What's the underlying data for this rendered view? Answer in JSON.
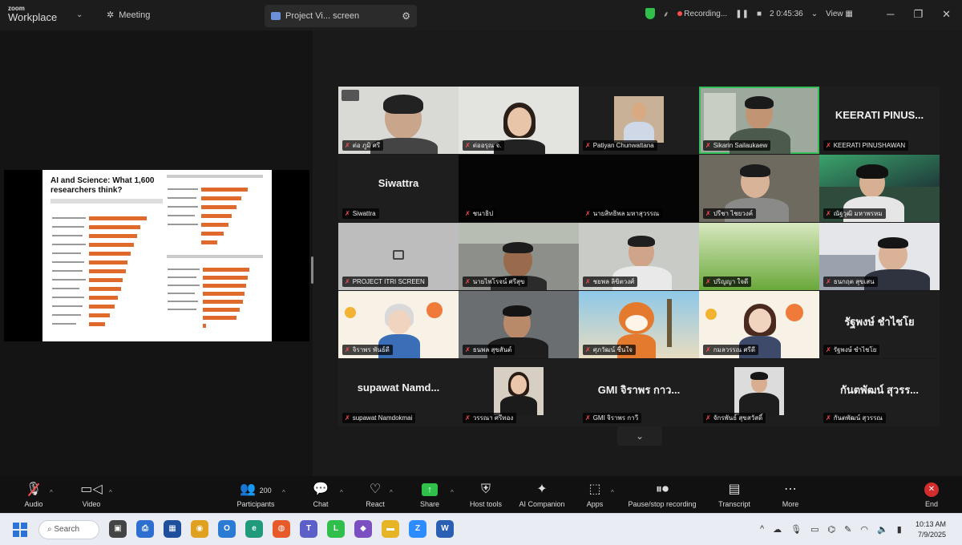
{
  "app": {
    "logo_top": "zoom",
    "logo_bottom": "Workplace",
    "meeting_label": "Meeting",
    "share_tab_label": "Project Vi... screen",
    "recording_label": "Recording...",
    "participants_short": "2 0:45:36",
    "view_label": "View"
  },
  "slide": {
    "title": "AI and Science: What 1,600 researchers think?"
  },
  "tiles": [
    {
      "name": "ต่อ ภูมิ ศรี"
    },
    {
      "name": "ต่ออรุณ จ."
    },
    {
      "name": "Patiyan Chunwattana"
    },
    {
      "name": "Sikarin Sailaukaew"
    },
    {
      "name": "KEERATI PINUSHAWAN",
      "display": "KEERATI PINUS..."
    },
    {
      "name": "Siwattra",
      "display": "Siwattra"
    },
    {
      "name": "ชนาธิป"
    },
    {
      "name": "นายสิทธิพล มหาสุวรรณ"
    },
    {
      "name": "ปรีชา ไชยวงค์"
    },
    {
      "name": "ณัฐวุฒิ มหาพรหม"
    },
    {
      "name": "PROJECT ITRI SCREEN"
    },
    {
      "name": "นายไพโรจน์ ศรีสุข"
    },
    {
      "name": "ชยพล ลิขิตวงศ์"
    },
    {
      "name": "ปริญญา ใจดี"
    },
    {
      "name": "ธนกฤต สุขเสน"
    },
    {
      "name": "จิราพร พันธ์ดี"
    },
    {
      "name": "ธนพล สุขสันต์"
    },
    {
      "name": "ศุภวัฒน์ ชื่นใจ"
    },
    {
      "name": "กมลวรรณ ศรีดี"
    },
    {
      "name": "รัฐพงษ์ ชำไชโย",
      "display": "รัฐพงษ์ ชำไชโย"
    },
    {
      "name": "supawat Namdokmai",
      "display": "supawat Namd..."
    },
    {
      "name": "วรรณา ศรีทอง"
    },
    {
      "name": "GMI จิราพร กาวี",
      "display": "GMI จิราพร กาว..."
    },
    {
      "name": "จักรพันธ์ สุขสวัสดิ์"
    },
    {
      "name": "กันตพัฒน์ สุวรรณ",
      "display": "กันตพัฒน์ สุวรร..."
    }
  ],
  "toolbar": {
    "audio": "Audio",
    "video": "Video",
    "participants": "Participants",
    "participants_count": "200",
    "chat": "Chat",
    "react": "React",
    "share": "Share",
    "host_tools": "Host tools",
    "ai_companion": "AI Companion",
    "apps": "Apps",
    "pause_recording": "Pause/stop recording",
    "transcript": "Transcript",
    "more": "More",
    "end": "End"
  },
  "taskbar": {
    "search": "Search",
    "time": "10:13 AM",
    "date": "7/9/2025"
  },
  "colors": {
    "accent_green": "#36c05c",
    "share_green": "#2fbf4a",
    "end_red": "#d42b2b",
    "bar_orange": "#e06a2c"
  }
}
